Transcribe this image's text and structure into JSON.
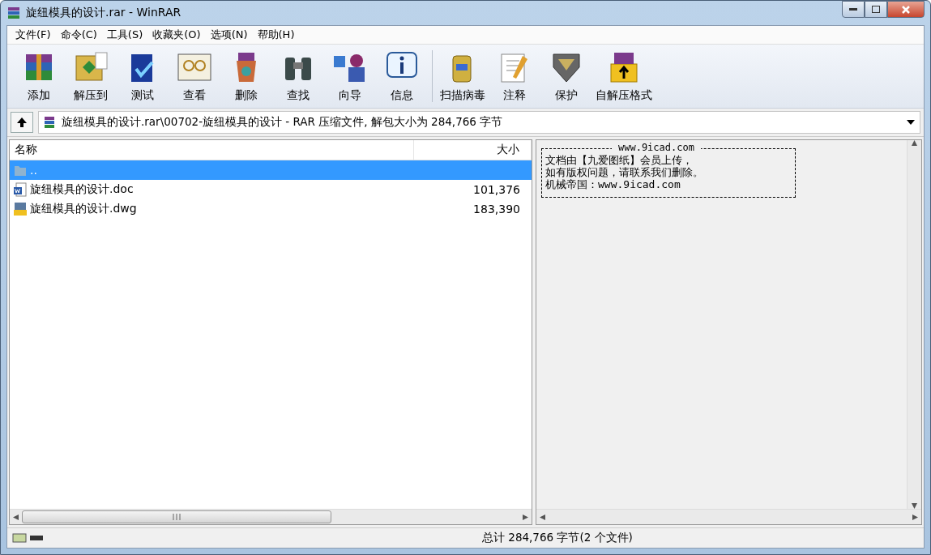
{
  "window": {
    "title": "旋纽模具的设计.rar - WinRAR"
  },
  "menu": [
    "文件(F)",
    "命令(C)",
    "工具(S)",
    "收藏夹(O)",
    "选项(N)",
    "帮助(H)"
  ],
  "toolbar": [
    "添加",
    "解压到",
    "测试",
    "查看",
    "删除",
    "查找",
    "向导",
    "信息",
    "扫描病毒",
    "注释",
    "保护",
    "自解压格式"
  ],
  "address": "旋纽模具的设计.rar\\00702-旋纽模具的设计 - RAR 压缩文件, 解包大小为 284,766 字节",
  "table": {
    "columns": [
      "名称",
      "大小"
    ],
    "rows": [
      {
        "kind": "folder",
        "name": "..",
        "size": "",
        "selected": true
      },
      {
        "kind": "doc",
        "name": "旋纽模具的设计.doc",
        "size": "101,376",
        "selected": false
      },
      {
        "kind": "dwg",
        "name": "旋纽模具的设计.dwg",
        "size": "183,390",
        "selected": false
      }
    ]
  },
  "comment": {
    "heading": "www.9icad.com",
    "lines": [
      "文档由【九爱图纸】会员上传，",
      "如有版权问题，请联系我们删除。",
      "机械帝国：www.9icad.com"
    ]
  },
  "status_bar": {
    "text": "总计 284,766 字节(2 个文件)"
  }
}
